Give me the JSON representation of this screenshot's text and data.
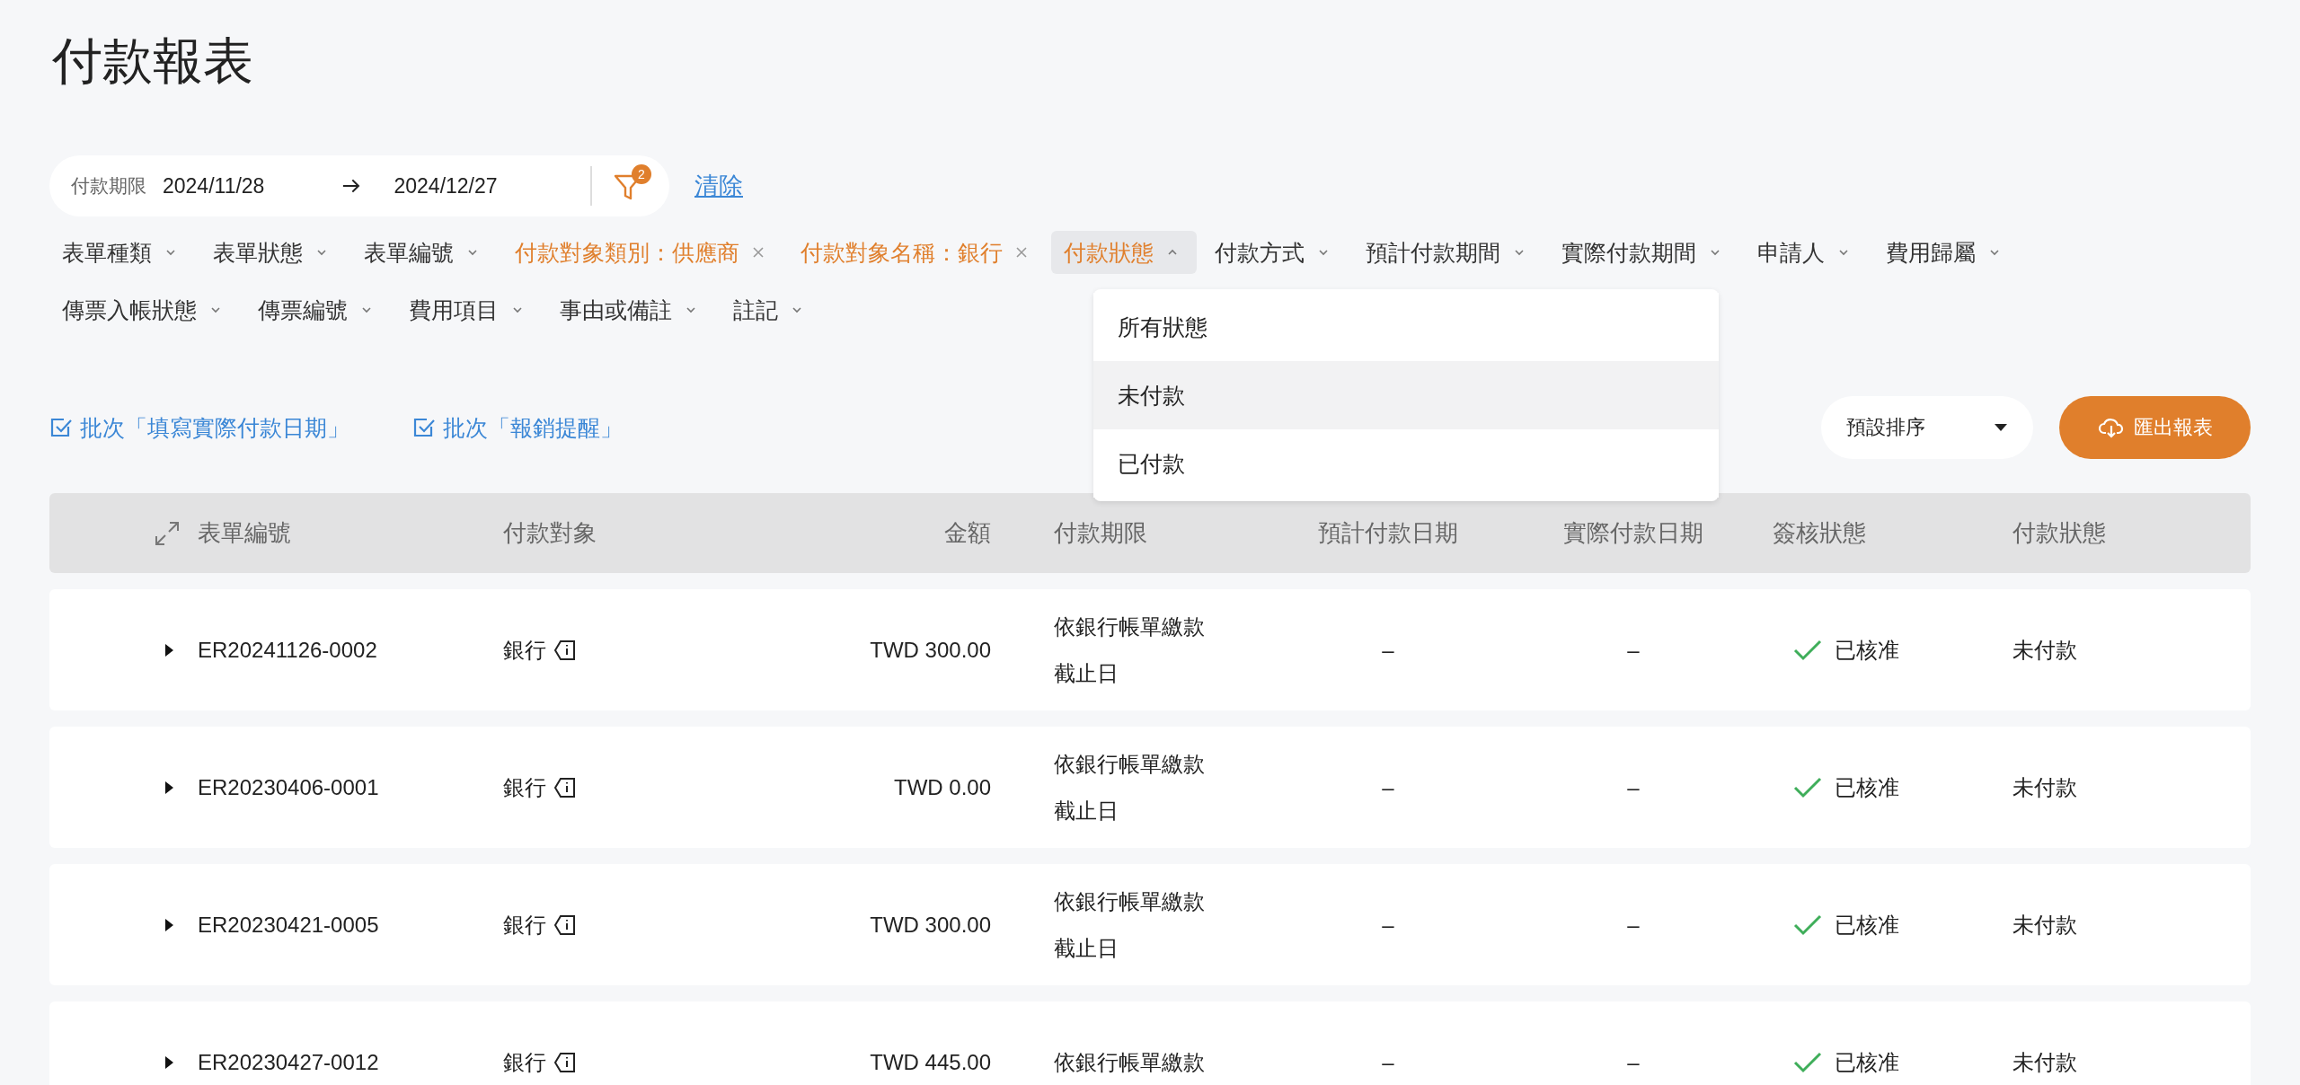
{
  "title": "付款報表",
  "date_filter": {
    "label": "付款期限",
    "from": "2024/11/28",
    "to": "2024/12/27",
    "filter_count": "2",
    "clear": "清除"
  },
  "filters": [
    {
      "label": "表單種類",
      "applied": false,
      "expanded": false
    },
    {
      "label": "表單狀態",
      "applied": false,
      "expanded": false
    },
    {
      "label": "表單編號",
      "applied": false,
      "expanded": false
    },
    {
      "label": "付款對象類別：供應商",
      "applied": true,
      "expanded": false
    },
    {
      "label": "付款對象名稱：銀行",
      "applied": true,
      "expanded": false
    },
    {
      "label": "付款狀態",
      "applied": false,
      "expanded": true
    },
    {
      "label": "付款方式",
      "applied": false,
      "expanded": false
    },
    {
      "label": "預計付款期間",
      "applied": false,
      "expanded": false
    },
    {
      "label": "實際付款期間",
      "applied": false,
      "expanded": false
    },
    {
      "label": "申請人",
      "applied": false,
      "expanded": false
    },
    {
      "label": "費用歸屬",
      "applied": false,
      "expanded": false
    },
    {
      "label": "傳票入帳狀態",
      "applied": false,
      "expanded": false
    },
    {
      "label": "傳票編號",
      "applied": false,
      "expanded": false
    },
    {
      "label": "費用項目",
      "applied": false,
      "expanded": false
    },
    {
      "label": "事由或備註",
      "applied": false,
      "expanded": false
    },
    {
      "label": "註記",
      "applied": false,
      "expanded": false
    }
  ],
  "status_menu": [
    {
      "label": "所有狀態",
      "highlighted": false
    },
    {
      "label": "未付款",
      "highlighted": true
    },
    {
      "label": "已付款",
      "highlighted": false
    }
  ],
  "batch_actions": [
    "批次「填寫實際付款日期」",
    "批次「報銷提醒」"
  ],
  "sort": {
    "value": "預設排序"
  },
  "export_button": "匯出報表",
  "table": {
    "columns": [
      "表單編號",
      "付款對象",
      "金額",
      "付款期限",
      "預計付款日期",
      "實際付款日期",
      "簽核狀態",
      "付款狀態"
    ],
    "rows": [
      {
        "expanded": false,
        "id": "ER20241126-0002",
        "payee": "銀行",
        "amount": "TWD 300.00",
        "deadline": [
          "依銀行帳單繳款",
          "截止日"
        ],
        "planned": "–",
        "actual": "–",
        "approval": {
          "approved": true,
          "text": "已核准"
        },
        "payment": "未付款"
      },
      {
        "expanded": false,
        "id": "ER20230406-0001",
        "payee": "銀行",
        "amount": "TWD 0.00",
        "deadline": [
          "依銀行帳單繳款",
          "截止日"
        ],
        "planned": "–",
        "actual": "–",
        "approval": {
          "approved": true,
          "text": "已核准"
        },
        "payment": "未付款"
      },
      {
        "expanded": false,
        "id": "ER20230421-0005",
        "payee": "銀行",
        "amount": "TWD 300.00",
        "deadline": [
          "依銀行帳單繳款",
          "截止日"
        ],
        "planned": "–",
        "actual": "–",
        "approval": {
          "approved": true,
          "text": "已核准"
        },
        "payment": "未付款"
      },
      {
        "expanded": false,
        "id": "ER20230427-0012",
        "payee": "銀行",
        "amount": "TWD 445.00",
        "deadline": [
          "依銀行帳單繳款"
        ],
        "planned": "–",
        "actual": "–",
        "approval": {
          "approved": true,
          "text": "已核准"
        },
        "payment": "未付款"
      }
    ]
  }
}
